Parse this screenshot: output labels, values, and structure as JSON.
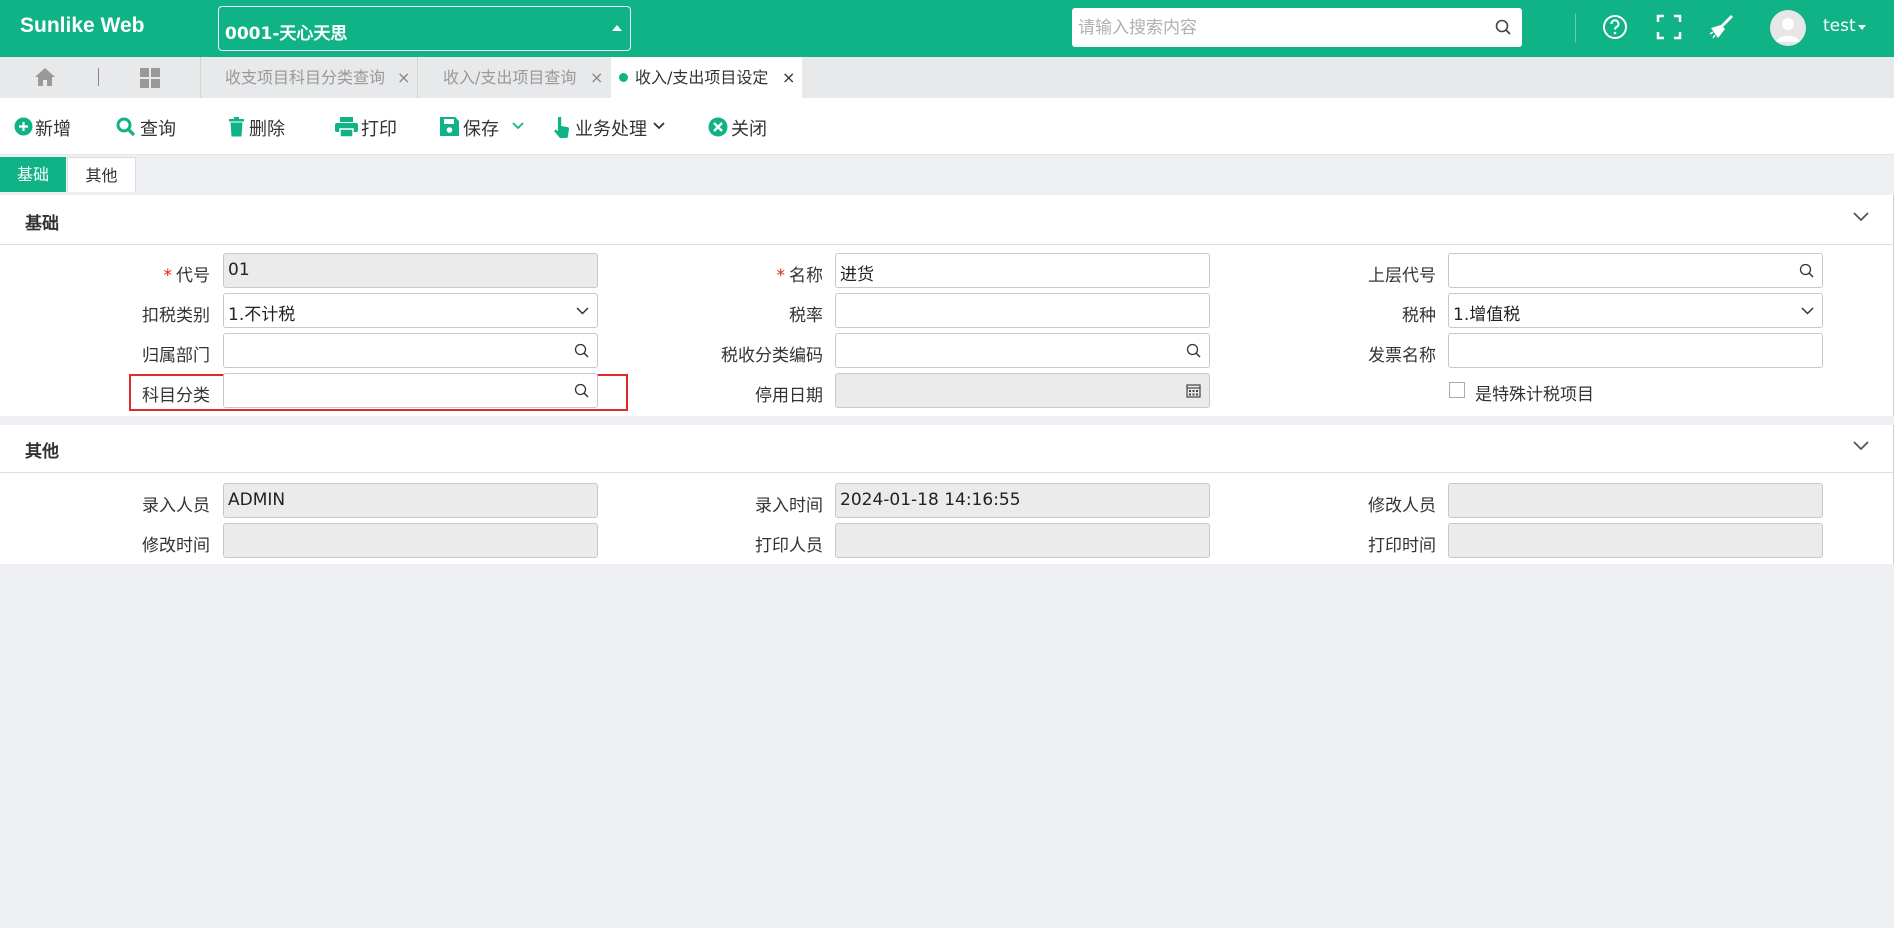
{
  "header": {
    "brand": "Sunlike Web",
    "company": "0001-天心天思",
    "search_placeholder": "请输入搜索内容",
    "username": "test",
    "icons": [
      "help-icon",
      "fullscreen-icon",
      "broom-icon",
      "user-avatar-icon"
    ]
  },
  "tabs": [
    {
      "label": "收支项目科目分类查询",
      "active": false
    },
    {
      "label": "收入/支出项目查询",
      "active": false
    },
    {
      "label": "收入/支出项目设定",
      "active": true
    }
  ],
  "toolbar": {
    "new": "新增",
    "query": "查询",
    "delete": "删除",
    "print": "打印",
    "save": "保存",
    "business": "业务处理",
    "close": "关闭"
  },
  "form_tabs": {
    "basic": "基础",
    "other": "其他"
  },
  "basic": {
    "title": "基础",
    "code_label": "代号",
    "code_value": "01",
    "name_label": "名称",
    "name_value": "进货",
    "parent_label": "上层代号",
    "parent_value": "",
    "tax_deduct_label": "扣税类别",
    "tax_deduct_value": "1.不计税",
    "tax_rate_label": "税率",
    "tax_rate_value": "",
    "tax_type_label": "税种",
    "tax_type_value": "1.增值税",
    "dept_label": "归属部门",
    "dept_value": "",
    "tax_class_label": "税收分类编码",
    "tax_class_value": "",
    "invoice_label": "发票名称",
    "invoice_value": "",
    "subject_label": "科目分类",
    "subject_value": "",
    "stop_date_label": "停用日期",
    "stop_date_value": "",
    "special_tax_label": "是特殊计税项目"
  },
  "other": {
    "title": "其他",
    "creator_label": "录入人员",
    "creator_value": "ADMIN",
    "create_time_label": "录入时间",
    "create_time_value": "2024-01-18 14:16:55",
    "modifier_label": "修改人员",
    "modifier_value": "",
    "modify_time_label": "修改时间",
    "modify_time_value": "",
    "printer_label": "打印人员",
    "printer_value": "",
    "print_time_label": "打印时间",
    "print_time_value": ""
  },
  "colors": {
    "accent": "#10b385",
    "required": "#e02020",
    "highlight_border": "#e02a2a"
  }
}
